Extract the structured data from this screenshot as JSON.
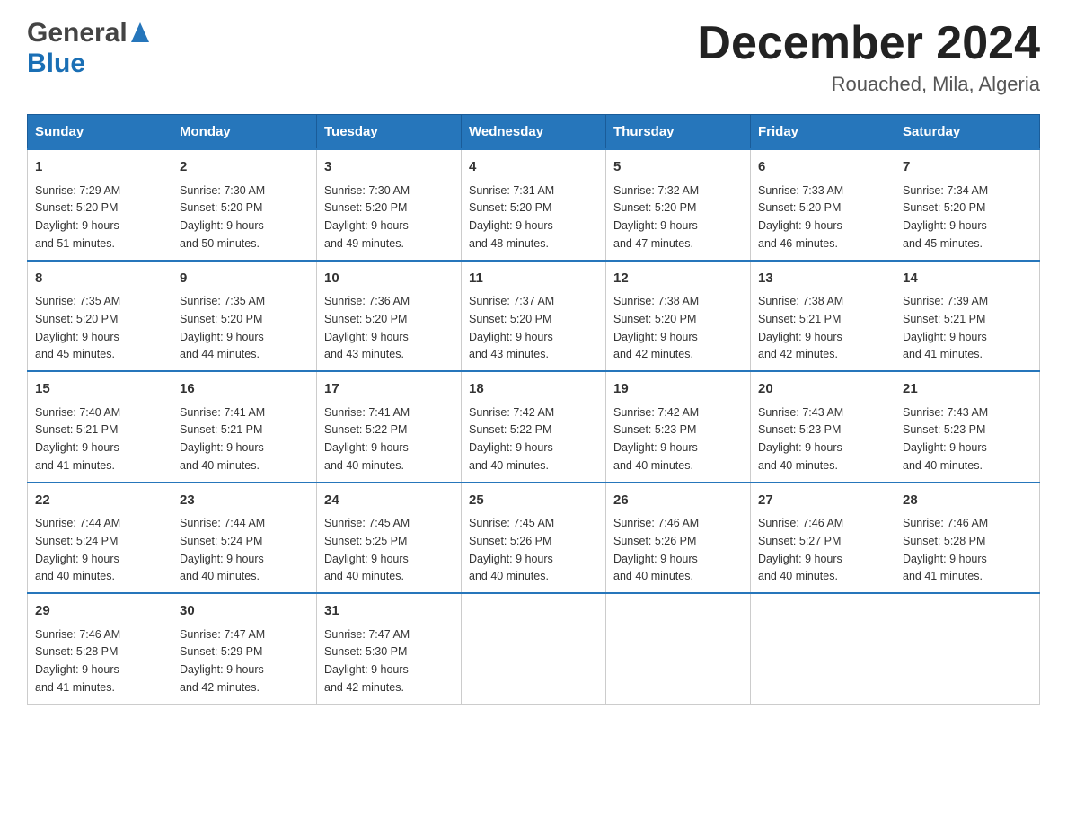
{
  "logo": {
    "general": "General",
    "blue": "Blue"
  },
  "title": "December 2024",
  "location": "Rouached, Mila, Algeria",
  "days_of_week": [
    "Sunday",
    "Monday",
    "Tuesday",
    "Wednesday",
    "Thursday",
    "Friday",
    "Saturday"
  ],
  "weeks": [
    [
      {
        "num": "1",
        "sunrise": "7:29 AM",
        "sunset": "5:20 PM",
        "daylight": "9 hours and 51 minutes."
      },
      {
        "num": "2",
        "sunrise": "7:30 AM",
        "sunset": "5:20 PM",
        "daylight": "9 hours and 50 minutes."
      },
      {
        "num": "3",
        "sunrise": "7:30 AM",
        "sunset": "5:20 PM",
        "daylight": "9 hours and 49 minutes."
      },
      {
        "num": "4",
        "sunrise": "7:31 AM",
        "sunset": "5:20 PM",
        "daylight": "9 hours and 48 minutes."
      },
      {
        "num": "5",
        "sunrise": "7:32 AM",
        "sunset": "5:20 PM",
        "daylight": "9 hours and 47 minutes."
      },
      {
        "num": "6",
        "sunrise": "7:33 AM",
        "sunset": "5:20 PM",
        "daylight": "9 hours and 46 minutes."
      },
      {
        "num": "7",
        "sunrise": "7:34 AM",
        "sunset": "5:20 PM",
        "daylight": "9 hours and 45 minutes."
      }
    ],
    [
      {
        "num": "8",
        "sunrise": "7:35 AM",
        "sunset": "5:20 PM",
        "daylight": "9 hours and 45 minutes."
      },
      {
        "num": "9",
        "sunrise": "7:35 AM",
        "sunset": "5:20 PM",
        "daylight": "9 hours and 44 minutes."
      },
      {
        "num": "10",
        "sunrise": "7:36 AM",
        "sunset": "5:20 PM",
        "daylight": "9 hours and 43 minutes."
      },
      {
        "num": "11",
        "sunrise": "7:37 AM",
        "sunset": "5:20 PM",
        "daylight": "9 hours and 43 minutes."
      },
      {
        "num": "12",
        "sunrise": "7:38 AM",
        "sunset": "5:20 PM",
        "daylight": "9 hours and 42 minutes."
      },
      {
        "num": "13",
        "sunrise": "7:38 AM",
        "sunset": "5:21 PM",
        "daylight": "9 hours and 42 minutes."
      },
      {
        "num": "14",
        "sunrise": "7:39 AM",
        "sunset": "5:21 PM",
        "daylight": "9 hours and 41 minutes."
      }
    ],
    [
      {
        "num": "15",
        "sunrise": "7:40 AM",
        "sunset": "5:21 PM",
        "daylight": "9 hours and 41 minutes."
      },
      {
        "num": "16",
        "sunrise": "7:41 AM",
        "sunset": "5:21 PM",
        "daylight": "9 hours and 40 minutes."
      },
      {
        "num": "17",
        "sunrise": "7:41 AM",
        "sunset": "5:22 PM",
        "daylight": "9 hours and 40 minutes."
      },
      {
        "num": "18",
        "sunrise": "7:42 AM",
        "sunset": "5:22 PM",
        "daylight": "9 hours and 40 minutes."
      },
      {
        "num": "19",
        "sunrise": "7:42 AM",
        "sunset": "5:23 PM",
        "daylight": "9 hours and 40 minutes."
      },
      {
        "num": "20",
        "sunrise": "7:43 AM",
        "sunset": "5:23 PM",
        "daylight": "9 hours and 40 minutes."
      },
      {
        "num": "21",
        "sunrise": "7:43 AM",
        "sunset": "5:23 PM",
        "daylight": "9 hours and 40 minutes."
      }
    ],
    [
      {
        "num": "22",
        "sunrise": "7:44 AM",
        "sunset": "5:24 PM",
        "daylight": "9 hours and 40 minutes."
      },
      {
        "num": "23",
        "sunrise": "7:44 AM",
        "sunset": "5:24 PM",
        "daylight": "9 hours and 40 minutes."
      },
      {
        "num": "24",
        "sunrise": "7:45 AM",
        "sunset": "5:25 PM",
        "daylight": "9 hours and 40 minutes."
      },
      {
        "num": "25",
        "sunrise": "7:45 AM",
        "sunset": "5:26 PM",
        "daylight": "9 hours and 40 minutes."
      },
      {
        "num": "26",
        "sunrise": "7:46 AM",
        "sunset": "5:26 PM",
        "daylight": "9 hours and 40 minutes."
      },
      {
        "num": "27",
        "sunrise": "7:46 AM",
        "sunset": "5:27 PM",
        "daylight": "9 hours and 40 minutes."
      },
      {
        "num": "28",
        "sunrise": "7:46 AM",
        "sunset": "5:28 PM",
        "daylight": "9 hours and 41 minutes."
      }
    ],
    [
      {
        "num": "29",
        "sunrise": "7:46 AM",
        "sunset": "5:28 PM",
        "daylight": "9 hours and 41 minutes."
      },
      {
        "num": "30",
        "sunrise": "7:47 AM",
        "sunset": "5:29 PM",
        "daylight": "9 hours and 42 minutes."
      },
      {
        "num": "31",
        "sunrise": "7:47 AM",
        "sunset": "5:30 PM",
        "daylight": "9 hours and 42 minutes."
      },
      null,
      null,
      null,
      null
    ]
  ],
  "labels": {
    "sunrise": "Sunrise:",
    "sunset": "Sunset:",
    "daylight": "Daylight:"
  }
}
